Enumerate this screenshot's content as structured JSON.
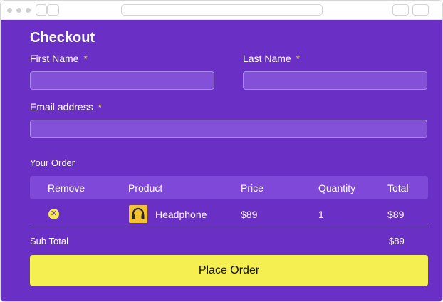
{
  "page": {
    "title": "Checkout"
  },
  "form": {
    "first_name": {
      "label": "First Name",
      "required_mark": "*",
      "value": ""
    },
    "last_name": {
      "label": "Last Name",
      "required_mark": "*",
      "value": ""
    },
    "email": {
      "label": "Email address",
      "required_mark": "*",
      "value": ""
    }
  },
  "order": {
    "section_title": "Your Order",
    "columns": [
      "Remove",
      "Product",
      "Price",
      "Quantity",
      "Total"
    ],
    "items": [
      {
        "remove_icon": "remove-x-icon",
        "product_icon": "headphone-icon",
        "product": "Headphone",
        "price": "$89",
        "quantity": "1",
        "total": "$89"
      }
    ],
    "subtotal_label": "Sub Total",
    "subtotal_value": "$89"
  },
  "actions": {
    "place_order": "Place Order"
  },
  "colors": {
    "background": "#6a2fc4",
    "accent": "#f5ef52",
    "table_header": "#7f48d8",
    "input_fill": "#8350d8"
  }
}
